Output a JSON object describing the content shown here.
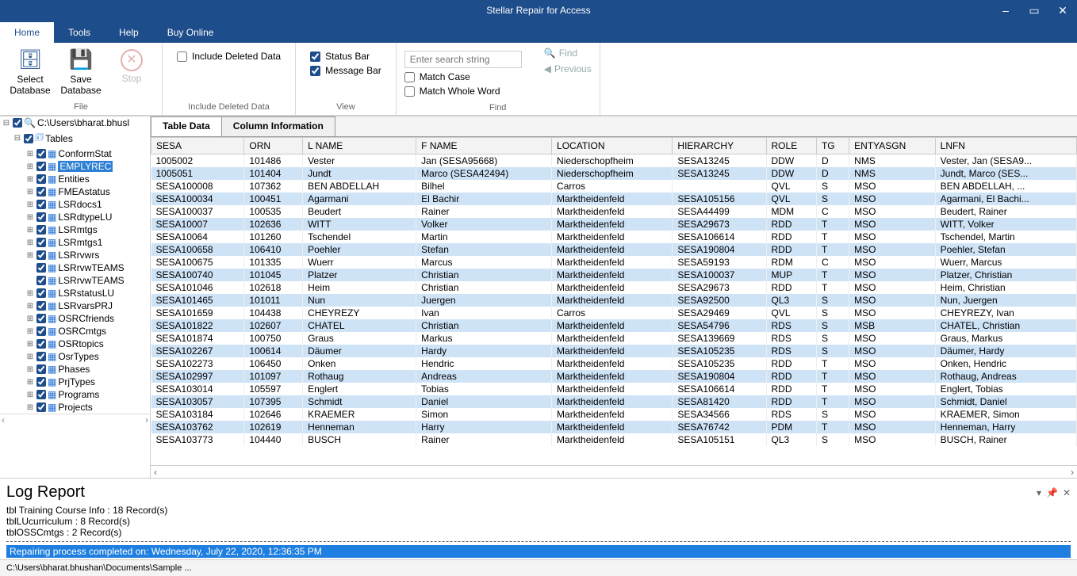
{
  "title": "Stellar Repair for Access",
  "tabs": [
    "Home",
    "Tools",
    "Help",
    "Buy Online"
  ],
  "ribbon": {
    "file": {
      "select": "Select\nDatabase",
      "save": "Save\nDatabase",
      "stop": "Stop",
      "label": "File"
    },
    "include": {
      "opt": "Include Deleted Data",
      "label": "Include Deleted Data"
    },
    "view": {
      "status": "Status Bar",
      "message": "Message Bar",
      "label": "View"
    },
    "find": {
      "placeholder": "Enter search string",
      "match_case": "Match Case",
      "match_word": "Match Whole Word",
      "find": "Find",
      "previous": "Previous",
      "label": "Find"
    }
  },
  "tree": {
    "root": "C:\\Users\\bharat.bhusl",
    "tables": "Tables",
    "items": [
      "ConformStat",
      "EMPLYREC",
      "Entities",
      "FMEAstatus",
      "LSRdocs1",
      "LSRdtypeLU",
      "LSRmtgs",
      "LSRmtgs1",
      "LSRrvwrs",
      "LSRrvwTEAMS",
      "LSRrvwTEAMS",
      "LSRstatusLU",
      "LSRvarsPRJ",
      "OSRCfriends",
      "OSRCmtgs",
      "OSRtopics",
      "OsrTypes",
      "Phases",
      "PrjTypes",
      "Programs",
      "Projects"
    ]
  },
  "grid_tabs": [
    "Table Data",
    "Column Information"
  ],
  "columns": [
    "SESA",
    "ORN",
    "L NAME",
    "F NAME",
    "LOCATION",
    "HIERARCHY",
    "ROLE",
    "TG",
    "ENTYASGN",
    "LNFN"
  ],
  "rows": [
    {
      "hl": 0,
      "c": [
        "1005002",
        "101486",
        "Vester",
        "Jan (SESA95668)",
        "Niederschopfheim",
        "SESA13245",
        "DDW",
        "D",
        "NMS",
        "Vester, Jan (SESA9..."
      ]
    },
    {
      "hl": 1,
      "c": [
        "1005051",
        "101404",
        "Jundt",
        "Marco (SESA42494)",
        "Niederschopfheim",
        "SESA13245",
        "DDW",
        "D",
        "NMS",
        "Jundt, Marco (SES..."
      ]
    },
    {
      "hl": 0,
      "c": [
        "SESA100008",
        "107362",
        "BEN ABDELLAH",
        "Bilhel",
        "Carros",
        "",
        "QVL",
        "S",
        "MSO",
        "BEN ABDELLAH, ..."
      ]
    },
    {
      "hl": 1,
      "c": [
        "SESA100034",
        "100451",
        "Agarmani",
        "El Bachir",
        "Marktheidenfeld",
        "SESA105156",
        "QVL",
        "S",
        "MSO",
        "Agarmani, El Bachi..."
      ]
    },
    {
      "hl": 0,
      "c": [
        "SESA100037",
        "100535",
        "Beudert",
        "Rainer",
        "Marktheidenfeld",
        "SESA44499",
        "MDM",
        "C",
        "MSO",
        "Beudert, Rainer"
      ]
    },
    {
      "hl": 1,
      "c": [
        "SESA10007",
        "102636",
        "WITT",
        "Volker",
        "Marktheidenfeld",
        "SESA29673",
        "RDD",
        "T",
        "MSO",
        "WITT, Volker"
      ]
    },
    {
      "hl": 0,
      "c": [
        "SESA10064",
        "101260",
        "Tschendel",
        "Martin",
        "Marktheidenfeld",
        "SESA106614",
        "RDD",
        "T",
        "MSO",
        "Tschendel, Martin"
      ]
    },
    {
      "hl": 1,
      "c": [
        "SESA100658",
        "106410",
        "Poehler",
        "Stefan",
        "Marktheidenfeld",
        "SESA190804",
        "RDD",
        "T",
        "MSO",
        "Poehler, Stefan"
      ]
    },
    {
      "hl": 0,
      "c": [
        "SESA100675",
        "101335",
        "Wuerr",
        "Marcus",
        "Marktheidenfeld",
        "SESA59193",
        "RDM",
        "C",
        "MSO",
        "Wuerr, Marcus"
      ]
    },
    {
      "hl": 1,
      "c": [
        "SESA100740",
        "101045",
        "Platzer",
        "Christian",
        "Marktheidenfeld",
        "SESA100037",
        "MUP",
        "T",
        "MSO",
        "Platzer, Christian"
      ]
    },
    {
      "hl": 0,
      "c": [
        "SESA101046",
        "102618",
        "Heim",
        "Christian",
        "Marktheidenfeld",
        "SESA29673",
        "RDD",
        "T",
        "MSO",
        "Heim, Christian"
      ]
    },
    {
      "hl": 1,
      "c": [
        "SESA101465",
        "101011",
        "Nun",
        "Juergen",
        "Marktheidenfeld",
        "SESA92500",
        "QL3",
        "S",
        "MSO",
        "Nun, Juergen"
      ]
    },
    {
      "hl": 0,
      "c": [
        "SESA101659",
        "104438",
        "CHEYREZY",
        "Ivan",
        "Carros",
        "SESA29469",
        "QVL",
        "S",
        "MSO",
        "CHEYREZY, Ivan"
      ]
    },
    {
      "hl": 1,
      "c": [
        "SESA101822",
        "102607",
        "CHATEL",
        "Christian",
        "Marktheidenfeld",
        "SESA54796",
        "RDS",
        "S",
        "MSB",
        "CHATEL, Christian"
      ]
    },
    {
      "hl": 0,
      "c": [
        "SESA101874",
        "100750",
        "Graus",
        "Markus",
        "Marktheidenfeld",
        "SESA139669",
        "RDS",
        "S",
        "MSO",
        "Graus, Markus"
      ]
    },
    {
      "hl": 1,
      "c": [
        "SESA102267",
        "100614",
        "Däumer",
        "Hardy",
        "Marktheidenfeld",
        "SESA105235",
        "RDS",
        "S",
        "MSO",
        "Däumer, Hardy"
      ]
    },
    {
      "hl": 0,
      "c": [
        "SESA102273",
        "106450",
        "Onken",
        "Hendric",
        "Marktheidenfeld",
        "SESA105235",
        "RDD",
        "T",
        "MSO",
        "Onken, Hendric"
      ]
    },
    {
      "hl": 1,
      "c": [
        "SESA102997",
        "101097",
        "Rothaug",
        "Andreas",
        "Marktheidenfeld",
        "SESA190804",
        "RDD",
        "T",
        "MSO",
        "Rothaug, Andreas"
      ]
    },
    {
      "hl": 0,
      "c": [
        "SESA103014",
        "105597",
        "Englert",
        "Tobias",
        "Marktheidenfeld",
        "SESA106614",
        "RDD",
        "T",
        "MSO",
        "Englert, Tobias"
      ]
    },
    {
      "hl": 1,
      "c": [
        "SESA103057",
        "107395",
        "Schmidt",
        "Daniel",
        "Marktheidenfeld",
        "SESA81420",
        "RDD",
        "T",
        "MSO",
        "Schmidt, Daniel"
      ]
    },
    {
      "hl": 0,
      "c": [
        "SESA103184",
        "102646",
        "KRAEMER",
        "Simon",
        "Marktheidenfeld",
        "SESA34566",
        "RDS",
        "S",
        "MSO",
        "KRAEMER, Simon"
      ]
    },
    {
      "hl": 1,
      "c": [
        "SESA103762",
        "102619",
        "Henneman",
        "Harry",
        "Marktheidenfeld",
        "SESA76742",
        "PDM",
        "T",
        "MSO",
        "Henneman, Harry"
      ]
    },
    {
      "hl": 0,
      "c": [
        "SESA103773",
        "104440",
        "BUSCH",
        "Rainer",
        "Marktheidenfeld",
        "SESA105151",
        "QL3",
        "S",
        "MSO",
        "BUSCH, Rainer"
      ]
    }
  ],
  "log": {
    "title": "Log Report",
    "lines": [
      "tbl Training Course Info  :  18 Record(s)",
      "tblLUcurriculum  :  8 Record(s)",
      "tblOSSCmtgs  :  2 Record(s)"
    ],
    "done": "Repairing process completed on: Wednesday, July 22, 2020, 12:36:35 PM"
  },
  "status": "C:\\Users\\bharat.bhushan\\Documents\\Sample ..."
}
